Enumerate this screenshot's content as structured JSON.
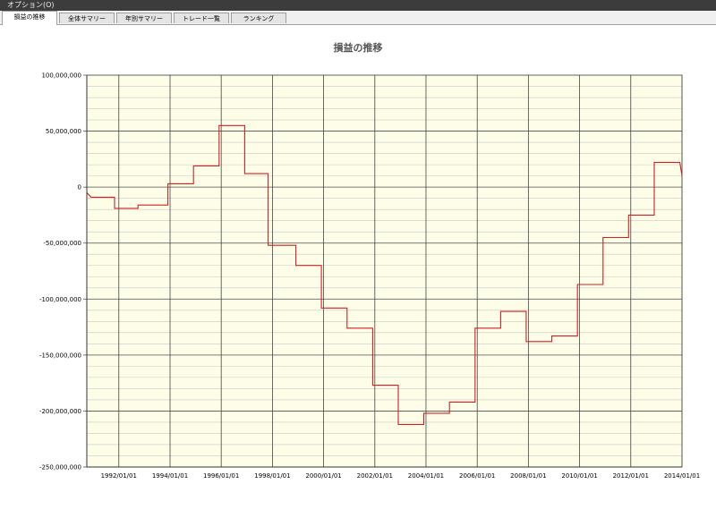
{
  "menu": {
    "label": "オプション(O)"
  },
  "tabs": [
    {
      "label": "損益の推移",
      "active": true
    },
    {
      "label": "全体サマリー",
      "active": false
    },
    {
      "label": "年別サマリー",
      "active": false
    },
    {
      "label": "トレード一覧",
      "active": false
    },
    {
      "label": "ランキング",
      "active": false
    }
  ],
  "chart_data": {
    "type": "line",
    "title": "損益の推移",
    "xlabel": "",
    "ylabel": "",
    "ylim": [
      -250000000,
      100000000
    ],
    "yticks": [
      {
        "value": 100000000,
        "label": "100,000,000"
      },
      {
        "value": 50000000,
        "label": "50,000,000"
      },
      {
        "value": 0,
        "label": "0"
      },
      {
        "value": -50000000,
        "label": "-50,000,000"
      },
      {
        "value": -100000000,
        "label": "-100,000,000"
      },
      {
        "value": -150000000,
        "label": "-150,000,000"
      },
      {
        "value": -200000000,
        "label": "-200,000,000"
      },
      {
        "value": -250000000,
        "label": "-250,000,000"
      }
    ],
    "xlim": [
      "1990-10-01",
      "2014-01-01"
    ],
    "xticks": [
      "1992/01/01",
      "1994/01/01",
      "1996/01/01",
      "1998/01/01",
      "2000/01/01",
      "2002/01/01",
      "2004/01/01",
      "2006/01/01",
      "2008/01/01",
      "2010/01/01",
      "2012/01/01",
      "2014/01/01"
    ],
    "minor_y_step": 10000000,
    "grid": true,
    "background_color": "#fdfde8",
    "line_color": "#cc2222",
    "series": [
      {
        "points": [
          [
            "1990-10-01",
            -5000000
          ],
          [
            "1990-12-01",
            -9000000
          ],
          [
            "1991-11-01",
            -9000000
          ],
          [
            "1991-11-01",
            -19000000
          ],
          [
            "1992-10-01",
            -19000000
          ],
          [
            "1992-10-01",
            -16000000
          ],
          [
            "1993-12-01",
            -16000000
          ],
          [
            "1993-12-01",
            3000000
          ],
          [
            "1994-12-01",
            3000000
          ],
          [
            "1994-12-01",
            19000000
          ],
          [
            "1995-12-01",
            19000000
          ],
          [
            "1995-12-01",
            55000000
          ],
          [
            "1996-12-01",
            55000000
          ],
          [
            "1996-12-01",
            12000000
          ],
          [
            "1997-11-01",
            12000000
          ],
          [
            "1997-11-01",
            -52000000
          ],
          [
            "1998-12-01",
            -52000000
          ],
          [
            "1998-12-01",
            -70000000
          ],
          [
            "1999-12-01",
            -70000000
          ],
          [
            "1999-12-01",
            -108000000
          ],
          [
            "2000-12-01",
            -108000000
          ],
          [
            "2000-12-01",
            -126000000
          ],
          [
            "2001-12-01",
            -126000000
          ],
          [
            "2001-12-01",
            -177000000
          ],
          [
            "2002-12-01",
            -177000000
          ],
          [
            "2002-12-01",
            -212000000
          ],
          [
            "2003-12-01",
            -212000000
          ],
          [
            "2003-12-01",
            -202000000
          ],
          [
            "2004-12-01",
            -202000000
          ],
          [
            "2004-12-01",
            -192000000
          ],
          [
            "2005-12-01",
            -192000000
          ],
          [
            "2005-12-01",
            -126000000
          ],
          [
            "2006-12-01",
            -126000000
          ],
          [
            "2006-12-01",
            -111000000
          ],
          [
            "2007-12-01",
            -111000000
          ],
          [
            "2007-12-01",
            -138000000
          ],
          [
            "2008-12-01",
            -138000000
          ],
          [
            "2008-12-01",
            -133000000
          ],
          [
            "2009-12-01",
            -133000000
          ],
          [
            "2009-12-01",
            -87000000
          ],
          [
            "2010-12-01",
            -87000000
          ],
          [
            "2010-12-01",
            -45000000
          ],
          [
            "2011-12-01",
            -45000000
          ],
          [
            "2011-12-01",
            -25000000
          ],
          [
            "2012-12-01",
            -25000000
          ],
          [
            "2012-12-01",
            22000000
          ],
          [
            "2013-12-01",
            22000000
          ],
          [
            "2014-01-01",
            10000000
          ]
        ]
      }
    ]
  }
}
